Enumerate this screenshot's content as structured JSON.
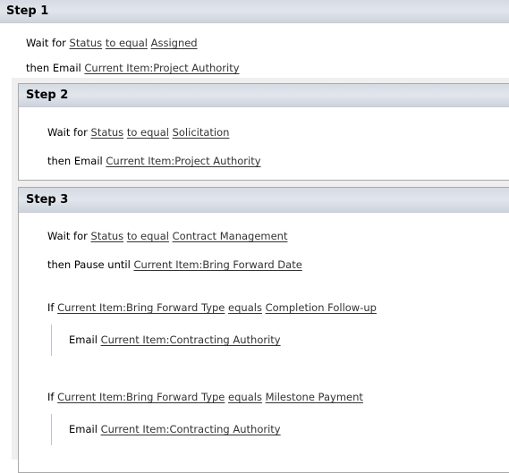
{
  "steps": [
    {
      "title": "Step 1",
      "lines": [
        {
          "prefix": "Wait for",
          "links": [
            "Status",
            "to equal",
            "Assigned"
          ]
        },
        {
          "prefix": "then Email",
          "links": [
            "Current Item:Project Authority"
          ]
        }
      ]
    },
    {
      "title": "Step 2",
      "lines": [
        {
          "prefix": "Wait for",
          "links": [
            "Status",
            "to equal",
            "Solicitation"
          ]
        },
        {
          "prefix": "then Email",
          "links": [
            "Current Item:Project Authority"
          ]
        }
      ]
    },
    {
      "title": "Step 3",
      "lines": [
        {
          "prefix": "Wait for",
          "links": [
            "Status",
            "to equal",
            "Contract Management"
          ]
        },
        {
          "prefix": "then Pause until",
          "links": [
            "Current Item:Bring Forward Date"
          ]
        }
      ],
      "conditions": [
        {
          "prefix": "If",
          "links": [
            "Current Item:Bring Forward Type",
            "equals",
            "Completion Follow-up"
          ],
          "action": {
            "prefix": "Email",
            "links": [
              "Current Item:Contracting Authority"
            ]
          }
        },
        {
          "prefix": "If",
          "links": [
            "Current Item:Bring Forward Type",
            "equals",
            "Milestone Payment"
          ],
          "action": {
            "prefix": "Email",
            "links": [
              "Current Item:Contracting Authority"
            ]
          }
        }
      ]
    }
  ]
}
